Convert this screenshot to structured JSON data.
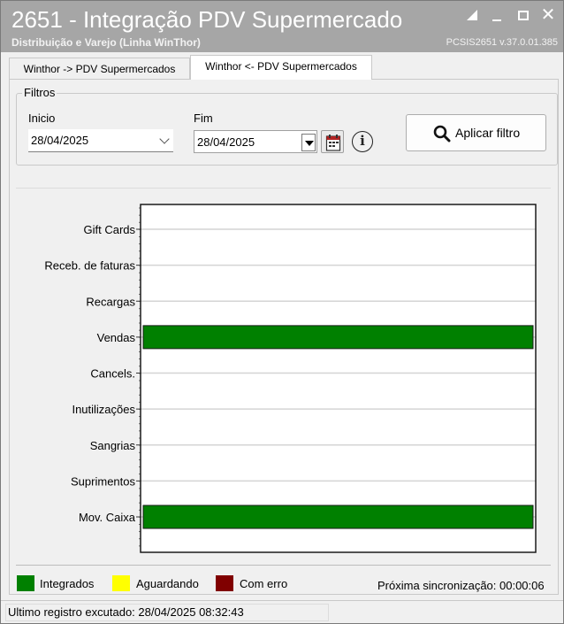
{
  "window": {
    "title": "2651 - Integração PDV Supermercado",
    "subtitle": "Distribuição e Varejo (Linha WinThor)",
    "version": "PCSIS2651  v.37.0.01.385",
    "controls": [
      "restore-icon",
      "minimize-icon",
      "maximize-icon",
      "close-icon"
    ]
  },
  "tabs": [
    {
      "label": "Winthor -> PDV Supermercados",
      "active": false
    },
    {
      "label": "Winthor <- PDV Supermercados",
      "active": true
    }
  ],
  "filters": {
    "group_label": "Filtros",
    "start_label": "Inicio",
    "start_value": "28/04/2025",
    "end_label": "Fim",
    "end_value": "28/04/2025",
    "info_icon": "i",
    "apply_label": "Aplicar filtro"
  },
  "chart_data": {
    "type": "bar",
    "orientation": "horizontal",
    "categories": [
      "Gift Cards",
      "Receb. de faturas",
      "Recargas",
      "Vendas",
      "Cancels.",
      "Inutilizações",
      "Sangrias",
      "Suprimentos",
      "Mov. Caixa"
    ],
    "series": [
      {
        "name": "Integrados",
        "color": "#008000",
        "values": [
          0,
          0,
          0,
          1,
          0,
          0,
          0,
          0,
          1
        ]
      },
      {
        "name": "Aguardando",
        "color": "#ffff00",
        "values": [
          0,
          0,
          0,
          0,
          0,
          0,
          0,
          0,
          0
        ]
      },
      {
        "name": "Com erro",
        "color": "#800000",
        "values": [
          0,
          0,
          0,
          0,
          0,
          0,
          0,
          0,
          0
        ]
      }
    ],
    "xlim": [
      0,
      1
    ],
    "grid": true,
    "legend_position": "bottom-left"
  },
  "legend": [
    {
      "label": "Integrados",
      "color": "#008000"
    },
    {
      "label": "Aguardando",
      "color": "#ffff00"
    },
    {
      "label": "Com erro",
      "color": "#800000"
    }
  ],
  "sync_text": "Próxima sincronização: 00:00:06",
  "status": {
    "text": "Ultimo registro excutado: 28/04/2025 08:32:43"
  }
}
